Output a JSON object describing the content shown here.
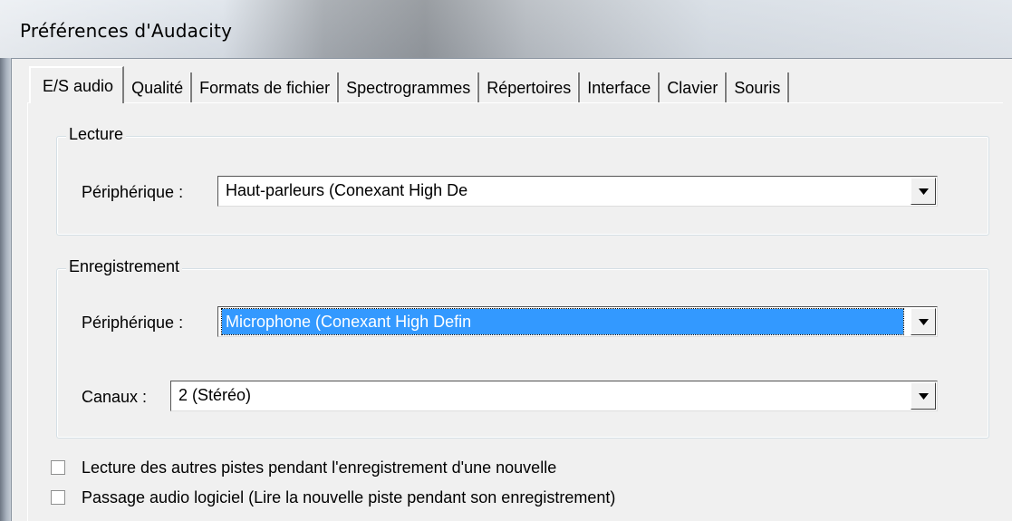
{
  "window": {
    "title": "Préférences d'Audacity"
  },
  "tabs": [
    {
      "label": "E/S audio",
      "active": true
    },
    {
      "label": "Qualité",
      "active": false
    },
    {
      "label": "Formats de fichier",
      "active": false
    },
    {
      "label": "Spectrogrammes",
      "active": false
    },
    {
      "label": "Répertoires",
      "active": false
    },
    {
      "label": "Interface",
      "active": false
    },
    {
      "label": "Clavier",
      "active": false
    },
    {
      "label": "Souris",
      "active": false
    }
  ],
  "playback": {
    "group_label": "Lecture",
    "device_label": "Périphérique :",
    "device_value": "Haut-parleurs (Conexant High De"
  },
  "recording": {
    "group_label": "Enregistrement",
    "device_label": "Périphérique :",
    "device_value": "Microphone (Conexant High Defin",
    "channels_label": "Canaux :",
    "channels_value": "2 (Stéréo)"
  },
  "options": {
    "overdub_label": "Lecture des autres pistes pendant l'enregistrement d'une nouvelle",
    "overdub_checked": false,
    "playthrough_label": "Passage audio logiciel (Lire la nouvelle piste pendant son enregistrement)",
    "playthrough_checked": false
  },
  "icons": {
    "dropdown_arrow": "chevron-down-icon",
    "checkbox": "checkbox-icon"
  },
  "colors": {
    "selection": "#3399ff",
    "selection_text": "#ffffff",
    "dialog_bg": "#f0f0f0"
  }
}
